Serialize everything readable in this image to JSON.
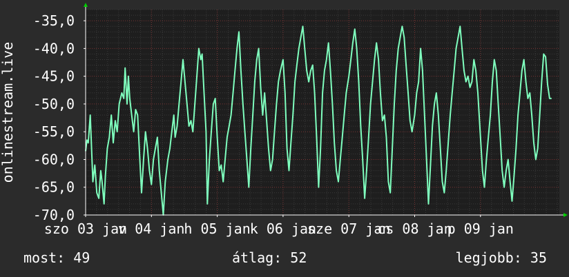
{
  "colors": {
    "background": "#2b2b2b",
    "plot_background": "#1e1e1e",
    "grid_minor": "#3a3a3a",
    "grid_major": "#7a3434",
    "series": "#7fffbe",
    "axis": "#ffffff",
    "arrow": "#00d000"
  },
  "footer": {
    "now_label": "most: 49",
    "avg_label": "átlag: 52",
    "best_label": "legjobb: 35"
  },
  "chart_data": {
    "type": "line",
    "ylabel": "onlinestream.live",
    "ylim": [
      -70,
      -33
    ],
    "yticks": [
      -70,
      -65,
      -60,
      -55,
      -50,
      -45,
      -40,
      -35
    ],
    "ytick_labels": [
      "-70,0",
      "-65,0",
      "-60,0",
      "-55,0",
      "-50,0",
      "-45,0",
      "-40,0",
      "-35,0"
    ],
    "xlim": [
      0,
      7.5
    ],
    "xticks": [
      {
        "x": 0.0,
        "label": "szo 03 jan"
      },
      {
        "x": 1.0,
        "label": "v 04 jan"
      },
      {
        "x": 2.0,
        "label": "h 05 jan"
      },
      {
        "x": 3.0,
        "label": "k 06 jan"
      },
      {
        "x": 4.0,
        "label": "sze 07 jan"
      },
      {
        "x": 5.0,
        "label": "cs 08 jan"
      },
      {
        "x": 6.0,
        "label": "p 09 jan"
      }
    ],
    "grid": true,
    "series": [
      {
        "points": [
          [
            0.0,
            -58.5
          ],
          [
            0.02,
            -56.5
          ],
          [
            0.04,
            -57.0
          ],
          [
            0.07,
            -52.0
          ],
          [
            0.09,
            -58.0
          ],
          [
            0.11,
            -64.0
          ],
          [
            0.14,
            -61.0
          ],
          [
            0.17,
            -66.0
          ],
          [
            0.2,
            -67.0
          ],
          [
            0.23,
            -62.0
          ],
          [
            0.25,
            -64.0
          ],
          [
            0.28,
            -68.0
          ],
          [
            0.3,
            -63.0
          ],
          [
            0.33,
            -58.0
          ],
          [
            0.36,
            -56.0
          ],
          [
            0.39,
            -52.0
          ],
          [
            0.42,
            -57.0
          ],
          [
            0.45,
            -53.0
          ],
          [
            0.48,
            -55.0
          ],
          [
            0.51,
            -50.0
          ],
          [
            0.55,
            -48.0
          ],
          [
            0.58,
            -49.0
          ],
          [
            0.6,
            -43.5
          ],
          [
            0.63,
            -50.0
          ],
          [
            0.65,
            -45.0
          ],
          [
            0.67,
            -49.0
          ],
          [
            0.7,
            -52.0
          ],
          [
            0.73,
            -55.0
          ],
          [
            0.76,
            -51.0
          ],
          [
            0.79,
            -52.0
          ],
          [
            0.82,
            -59.0
          ],
          [
            0.85,
            -66.0
          ],
          [
            0.88,
            -60.0
          ],
          [
            0.91,
            -55.0
          ],
          [
            0.94,
            -58.0
          ],
          [
            0.97,
            -62.0
          ],
          [
            1.0,
            -64.5
          ],
          [
            1.03,
            -60.0
          ],
          [
            1.06,
            -58.0
          ],
          [
            1.09,
            -56.0
          ],
          [
            1.12,
            -62.0
          ],
          [
            1.15,
            -66.0
          ],
          [
            1.18,
            -70.0
          ],
          [
            1.21,
            -64.0
          ],
          [
            1.25,
            -60.0
          ],
          [
            1.28,
            -58.0
          ],
          [
            1.31,
            -55.0
          ],
          [
            1.34,
            -52.0
          ],
          [
            1.36,
            -56.0
          ],
          [
            1.39,
            -54.0
          ],
          [
            1.42,
            -50.0
          ],
          [
            1.45,
            -46.0
          ],
          [
            1.48,
            -42.0
          ],
          [
            1.51,
            -46.0
          ],
          [
            1.54,
            -50.0
          ],
          [
            1.57,
            -54.0
          ],
          [
            1.6,
            -53.0
          ],
          [
            1.63,
            -55.0
          ],
          [
            1.66,
            -50.0
          ],
          [
            1.69,
            -45.0
          ],
          [
            1.72,
            -40.0
          ],
          [
            1.75,
            -42.0
          ],
          [
            1.77,
            -41.0
          ],
          [
            1.8,
            -48.0
          ],
          [
            1.83,
            -55.0
          ],
          [
            1.85,
            -68.0
          ],
          [
            1.88,
            -60.0
          ],
          [
            1.91,
            -55.0
          ],
          [
            1.94,
            -50.0
          ],
          [
            1.97,
            -49.0
          ],
          [
            2.0,
            -56.0
          ],
          [
            2.03,
            -62.0
          ],
          [
            2.06,
            -61.0
          ],
          [
            2.09,
            -64.0
          ],
          [
            2.12,
            -60.0
          ],
          [
            2.15,
            -56.0
          ],
          [
            2.18,
            -54.0
          ],
          [
            2.21,
            -52.0
          ],
          [
            2.24,
            -48.0
          ],
          [
            2.27,
            -44.0
          ],
          [
            2.3,
            -40.0
          ],
          [
            2.33,
            -37.0
          ],
          [
            2.36,
            -44.0
          ],
          [
            2.39,
            -50.0
          ],
          [
            2.42,
            -55.0
          ],
          [
            2.45,
            -60.0
          ],
          [
            2.48,
            -65.0
          ],
          [
            2.51,
            -58.0
          ],
          [
            2.54,
            -52.0
          ],
          [
            2.57,
            -46.0
          ],
          [
            2.6,
            -42.0
          ],
          [
            2.63,
            -40.0
          ],
          [
            2.66,
            -47.0
          ],
          [
            2.69,
            -52.0
          ],
          [
            2.72,
            -48.0
          ],
          [
            2.75,
            -53.0
          ],
          [
            2.78,
            -58.0
          ],
          [
            2.81,
            -62.0
          ],
          [
            2.84,
            -60.0
          ],
          [
            2.87,
            -55.0
          ],
          [
            2.9,
            -50.0
          ],
          [
            2.93,
            -46.0
          ],
          [
            2.96,
            -44.0
          ],
          [
            3.0,
            -42.0
          ],
          [
            3.03,
            -48.0
          ],
          [
            3.06,
            -58.0
          ],
          [
            3.09,
            -62.0
          ],
          [
            3.12,
            -57.0
          ],
          [
            3.15,
            -52.0
          ],
          [
            3.18,
            -46.0
          ],
          [
            3.21,
            -43.0
          ],
          [
            3.24,
            -40.0
          ],
          [
            3.27,
            -38.0
          ],
          [
            3.3,
            -36.0
          ],
          [
            3.33,
            -40.0
          ],
          [
            3.36,
            -44.0
          ],
          [
            3.39,
            -46.0
          ],
          [
            3.42,
            -44.0
          ],
          [
            3.45,
            -43.0
          ],
          [
            3.48,
            -48.0
          ],
          [
            3.51,
            -56.0
          ],
          [
            3.54,
            -65.0
          ],
          [
            3.57,
            -58.0
          ],
          [
            3.6,
            -48.0
          ],
          [
            3.63,
            -44.0
          ],
          [
            3.66,
            -42.0
          ],
          [
            3.69,
            -39.0
          ],
          [
            3.72,
            -44.0
          ],
          [
            3.75,
            -50.0
          ],
          [
            3.78,
            -57.0
          ],
          [
            3.81,
            -62.0
          ],
          [
            3.84,
            -64.0
          ],
          [
            3.87,
            -60.0
          ],
          [
            3.9,
            -56.0
          ],
          [
            3.93,
            -52.0
          ],
          [
            3.96,
            -48.0
          ],
          [
            4.0,
            -45.0
          ],
          [
            4.03,
            -42.0
          ],
          [
            4.06,
            -39.0
          ],
          [
            4.09,
            -36.5
          ],
          [
            4.12,
            -40.0
          ],
          [
            4.15,
            -46.0
          ],
          [
            4.18,
            -54.0
          ],
          [
            4.21,
            -60.0
          ],
          [
            4.24,
            -67.0
          ],
          [
            4.27,
            -62.0
          ],
          [
            4.3,
            -56.0
          ],
          [
            4.33,
            -50.0
          ],
          [
            4.36,
            -46.0
          ],
          [
            4.39,
            -42.0
          ],
          [
            4.42,
            -39.0
          ],
          [
            4.45,
            -42.0
          ],
          [
            4.48,
            -48.0
          ],
          [
            4.51,
            -53.0
          ],
          [
            4.54,
            -52.0
          ],
          [
            4.57,
            -56.0
          ],
          [
            4.6,
            -64.0
          ],
          [
            4.63,
            -66.0
          ],
          [
            4.66,
            -58.0
          ],
          [
            4.69,
            -50.0
          ],
          [
            4.72,
            -44.0
          ],
          [
            4.75,
            -40.0
          ],
          [
            4.78,
            -38.0
          ],
          [
            4.81,
            -36.0
          ],
          [
            4.84,
            -38.0
          ],
          [
            4.87,
            -43.0
          ],
          [
            4.9,
            -48.0
          ],
          [
            4.93,
            -53.0
          ],
          [
            4.96,
            -55.0
          ],
          [
            5.0,
            -52.0
          ],
          [
            5.03,
            -48.0
          ],
          [
            5.06,
            -46.0
          ],
          [
            5.09,
            -40.0
          ],
          [
            5.12,
            -44.0
          ],
          [
            5.15,
            -52.0
          ],
          [
            5.18,
            -60.0
          ],
          [
            5.21,
            -68.0
          ],
          [
            5.24,
            -61.0
          ],
          [
            5.27,
            -54.0
          ],
          [
            5.3,
            -50.0
          ],
          [
            5.33,
            -48.0
          ],
          [
            5.36,
            -52.0
          ],
          [
            5.39,
            -58.0
          ],
          [
            5.42,
            -64.0
          ],
          [
            5.45,
            -66.0
          ],
          [
            5.48,
            -62.0
          ],
          [
            5.51,
            -57.0
          ],
          [
            5.54,
            -52.0
          ],
          [
            5.57,
            -48.0
          ],
          [
            5.6,
            -44.0
          ],
          [
            5.63,
            -40.0
          ],
          [
            5.66,
            -38.0
          ],
          [
            5.69,
            -36.0
          ],
          [
            5.72,
            -40.0
          ],
          [
            5.75,
            -44.0
          ],
          [
            5.78,
            -46.0
          ],
          [
            5.81,
            -45.0
          ],
          [
            5.84,
            -47.0
          ],
          [
            5.87,
            -46.0
          ],
          [
            5.9,
            -42.0
          ],
          [
            5.93,
            -44.0
          ],
          [
            5.96,
            -48.0
          ],
          [
            6.0,
            -56.0
          ],
          [
            6.03,
            -62.0
          ],
          [
            6.06,
            -65.0
          ],
          [
            6.09,
            -60.0
          ],
          [
            6.12,
            -56.0
          ],
          [
            6.15,
            -52.0
          ],
          [
            6.18,
            -46.0
          ],
          [
            6.21,
            -42.0
          ],
          [
            6.24,
            -44.0
          ],
          [
            6.27,
            -50.0
          ],
          [
            6.3,
            -56.0
          ],
          [
            6.33,
            -62.0
          ],
          [
            6.36,
            -65.0
          ],
          [
            6.39,
            -62.0
          ],
          [
            6.42,
            -60.0
          ],
          [
            6.45,
            -64.0
          ],
          [
            6.48,
            -67.5
          ],
          [
            6.51,
            -63.0
          ],
          [
            6.54,
            -58.0
          ],
          [
            6.57,
            -52.0
          ],
          [
            6.6,
            -48.0
          ],
          [
            6.63,
            -44.0
          ],
          [
            6.66,
            -42.0
          ],
          [
            6.69,
            -46.0
          ],
          [
            6.72,
            -49.0
          ],
          [
            6.75,
            -48.0
          ],
          [
            6.78,
            -52.0
          ],
          [
            6.81,
            -57.0
          ],
          [
            6.84,
            -60.0
          ],
          [
            6.87,
            -58.0
          ],
          [
            6.9,
            -52.0
          ],
          [
            6.93,
            -46.0
          ],
          [
            6.96,
            -41.0
          ],
          [
            6.99,
            -41.5
          ],
          [
            7.02,
            -46.5
          ],
          [
            7.05,
            -49.0
          ],
          [
            7.08,
            -49.0
          ]
        ]
      }
    ]
  }
}
